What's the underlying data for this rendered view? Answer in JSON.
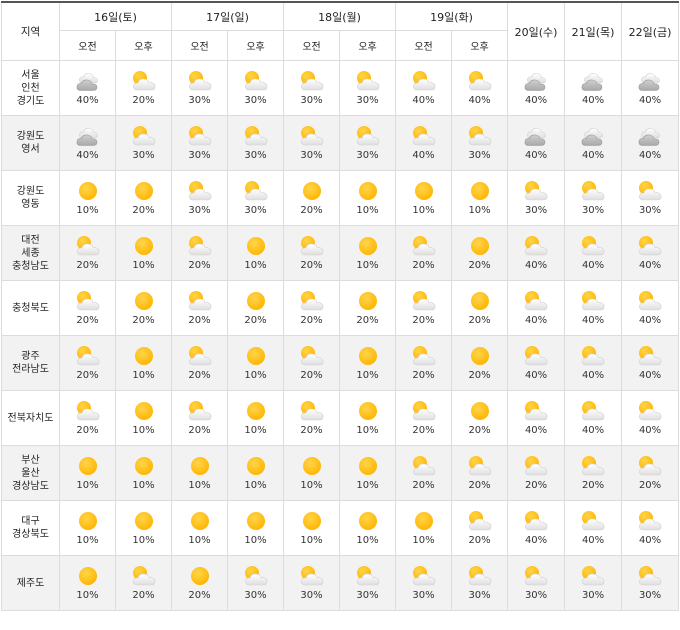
{
  "header": {
    "region_label": "지역",
    "split_days": [
      "16일(토)",
      "17일(일)",
      "18일(월)",
      "19일(화)"
    ],
    "am_label": "오전",
    "pm_label": "오후",
    "whole_days": [
      "20일(수)",
      "21일(목)",
      "22일(금)"
    ]
  },
  "icon_legend": {
    "sun": "sun-icon",
    "partly": "partly-cloudy-icon",
    "cloud": "cloudy-icon"
  },
  "rows": [
    {
      "region": [
        "서울",
        "인천",
        "경기도"
      ],
      "icons": [
        "cloud",
        "partly",
        "partly",
        "partly",
        "partly",
        "partly",
        "partly",
        "partly",
        "cloud",
        "cloud",
        "cloud"
      ],
      "pcts": [
        "40%",
        "20%",
        "30%",
        "30%",
        "30%",
        "30%",
        "40%",
        "40%",
        "40%",
        "40%",
        "40%"
      ]
    },
    {
      "region": [
        "강원도",
        "영서"
      ],
      "icons": [
        "cloud",
        "partly",
        "partly",
        "partly",
        "partly",
        "partly",
        "partly",
        "partly",
        "cloud",
        "cloud",
        "cloud"
      ],
      "pcts": [
        "40%",
        "30%",
        "30%",
        "30%",
        "30%",
        "30%",
        "40%",
        "30%",
        "40%",
        "40%",
        "40%"
      ]
    },
    {
      "region": [
        "강원도",
        "영동"
      ],
      "icons": [
        "sun",
        "sun",
        "partly",
        "partly",
        "sun",
        "sun",
        "sun",
        "sun",
        "partly",
        "partly",
        "partly"
      ],
      "pcts": [
        "10%",
        "20%",
        "30%",
        "30%",
        "20%",
        "10%",
        "10%",
        "10%",
        "30%",
        "30%",
        "30%"
      ]
    },
    {
      "region": [
        "대전",
        "세종",
        "충청남도"
      ],
      "icons": [
        "partly",
        "sun",
        "partly",
        "sun",
        "partly",
        "sun",
        "partly",
        "sun",
        "partly",
        "partly",
        "partly"
      ],
      "pcts": [
        "20%",
        "10%",
        "20%",
        "10%",
        "20%",
        "10%",
        "20%",
        "20%",
        "40%",
        "40%",
        "40%"
      ]
    },
    {
      "region": [
        "충청북도"
      ],
      "icons": [
        "partly",
        "sun",
        "partly",
        "sun",
        "partly",
        "sun",
        "partly",
        "sun",
        "partly",
        "partly",
        "partly"
      ],
      "pcts": [
        "20%",
        "20%",
        "20%",
        "20%",
        "20%",
        "20%",
        "20%",
        "20%",
        "40%",
        "40%",
        "40%"
      ]
    },
    {
      "region": [
        "광주",
        "전라남도"
      ],
      "icons": [
        "partly",
        "sun",
        "partly",
        "sun",
        "partly",
        "sun",
        "partly",
        "sun",
        "partly",
        "partly",
        "partly"
      ],
      "pcts": [
        "20%",
        "10%",
        "20%",
        "10%",
        "20%",
        "10%",
        "20%",
        "20%",
        "40%",
        "40%",
        "40%"
      ]
    },
    {
      "region": [
        "전북자치도"
      ],
      "icons": [
        "partly",
        "sun",
        "partly",
        "sun",
        "partly",
        "sun",
        "partly",
        "sun",
        "partly",
        "partly",
        "partly"
      ],
      "pcts": [
        "20%",
        "10%",
        "20%",
        "10%",
        "20%",
        "10%",
        "20%",
        "20%",
        "40%",
        "40%",
        "40%"
      ]
    },
    {
      "region": [
        "부산",
        "울산",
        "경상남도"
      ],
      "icons": [
        "sun",
        "sun",
        "sun",
        "sun",
        "sun",
        "sun",
        "partly",
        "partly",
        "partly",
        "partly",
        "partly"
      ],
      "pcts": [
        "10%",
        "10%",
        "10%",
        "10%",
        "10%",
        "10%",
        "20%",
        "20%",
        "20%",
        "20%",
        "20%"
      ]
    },
    {
      "region": [
        "대구",
        "경상북도"
      ],
      "icons": [
        "sun",
        "sun",
        "sun",
        "sun",
        "sun",
        "sun",
        "sun",
        "partly",
        "partly",
        "partly",
        "partly"
      ],
      "pcts": [
        "10%",
        "10%",
        "10%",
        "10%",
        "10%",
        "10%",
        "10%",
        "20%",
        "40%",
        "40%",
        "40%"
      ]
    },
    {
      "region": [
        "제주도"
      ],
      "icons": [
        "sun",
        "partly",
        "sun",
        "partly",
        "partly",
        "partly",
        "partly",
        "partly",
        "partly",
        "partly",
        "partly"
      ],
      "pcts": [
        "10%",
        "20%",
        "20%",
        "30%",
        "30%",
        "30%",
        "30%",
        "30%",
        "30%",
        "30%",
        "30%"
      ]
    }
  ],
  "colors": {
    "sun_outer": "#ffb400",
    "sun_inner": "#ffd54a",
    "cloud_light": "#f4f4f4",
    "cloud_dark": "#a8a8a8",
    "row_alt_bg": "#f2f2f2",
    "border": "#dcdcdc"
  }
}
